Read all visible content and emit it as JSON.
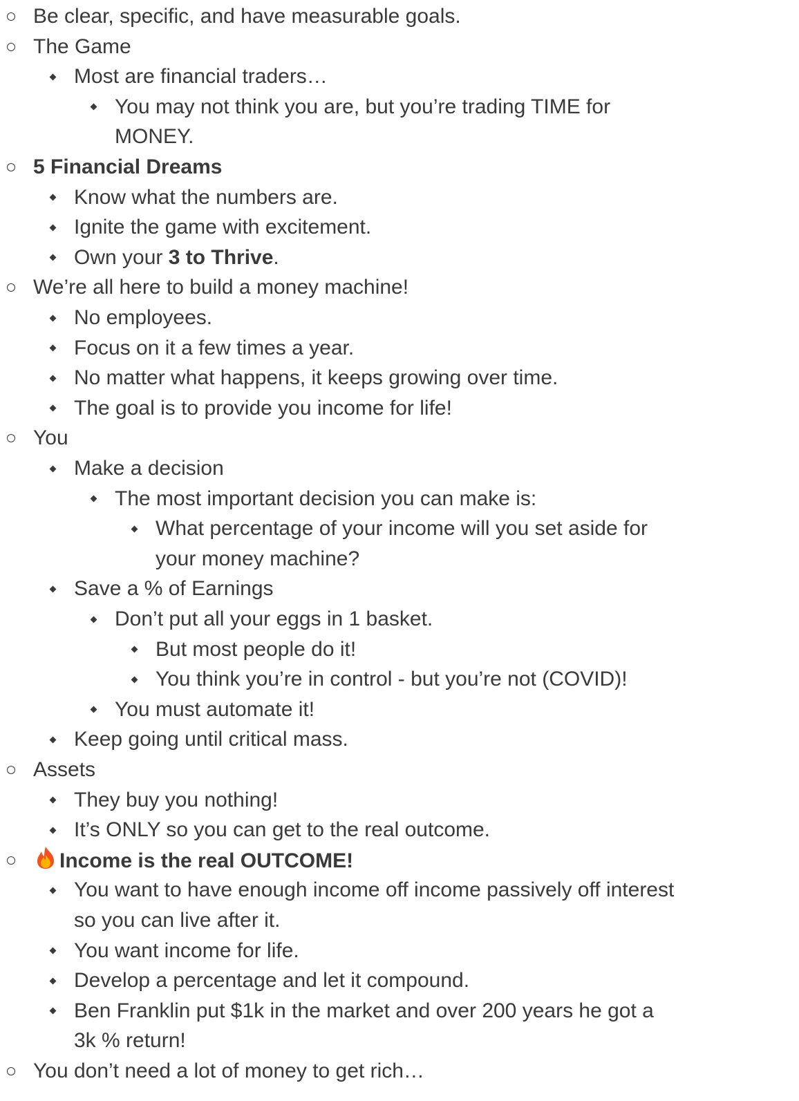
{
  "items": [
    {
      "level": 0,
      "lines": [
        [
          {
            "t": "Be clear, specific, and have measurable goals."
          }
        ]
      ]
    },
    {
      "level": 0,
      "lines": [
        [
          {
            "t": "The Game"
          }
        ]
      ]
    },
    {
      "level": 1,
      "lines": [
        [
          {
            "t": "Most are financial traders…"
          }
        ]
      ]
    },
    {
      "level": 2,
      "lines": [
        [
          {
            "t": "You may not think you are, but you’re trading TIME for"
          }
        ],
        [
          {
            "t": "MONEY."
          }
        ]
      ]
    },
    {
      "level": 0,
      "lines": [
        [
          {
            "t": "5 Financial Dreams",
            "b": true
          }
        ]
      ]
    },
    {
      "level": 1,
      "lines": [
        [
          {
            "t": "Know what the numbers are."
          }
        ]
      ]
    },
    {
      "level": 1,
      "lines": [
        [
          {
            "t": "Ignite the game with excitement."
          }
        ]
      ]
    },
    {
      "level": 1,
      "lines": [
        [
          {
            "t": "Own your "
          },
          {
            "t": "3 to Thrive",
            "b": true
          },
          {
            "t": "."
          }
        ]
      ]
    },
    {
      "level": 0,
      "lines": [
        [
          {
            "t": "We’re all here to build a money machine!"
          }
        ]
      ]
    },
    {
      "level": 1,
      "lines": [
        [
          {
            "t": "No employees."
          }
        ]
      ]
    },
    {
      "level": 1,
      "lines": [
        [
          {
            "t": "Focus on it a few times a year."
          }
        ]
      ]
    },
    {
      "level": 1,
      "lines": [
        [
          {
            "t": "No matter what happens, it keeps growing over time."
          }
        ]
      ]
    },
    {
      "level": 1,
      "lines": [
        [
          {
            "t": "The goal is to provide you income for life!"
          }
        ]
      ]
    },
    {
      "level": 0,
      "lines": [
        [
          {
            "t": "You"
          }
        ]
      ]
    },
    {
      "level": 1,
      "lines": [
        [
          {
            "t": "Make a decision"
          }
        ]
      ]
    },
    {
      "level": 2,
      "lines": [
        [
          {
            "t": "The most important decision you can make is:"
          }
        ]
      ]
    },
    {
      "level": 3,
      "lines": [
        [
          {
            "t": "What percentage of your income will you set aside for"
          }
        ],
        [
          {
            "t": "your money machine?"
          }
        ]
      ]
    },
    {
      "level": 1,
      "lines": [
        [
          {
            "t": "Save a % of Earnings"
          }
        ]
      ]
    },
    {
      "level": 2,
      "lines": [
        [
          {
            "t": "Don’t put all your eggs in 1 basket."
          }
        ]
      ]
    },
    {
      "level": 3,
      "lines": [
        [
          {
            "t": "But most people do it!"
          }
        ]
      ]
    },
    {
      "level": 3,
      "lines": [
        [
          {
            "t": "You think you’re in control - but you’re not (COVID)!"
          }
        ]
      ]
    },
    {
      "level": 2,
      "lines": [
        [
          {
            "t": "You must automate it!"
          }
        ]
      ]
    },
    {
      "level": 1,
      "lines": [
        [
          {
            "t": "Keep going until critical mass."
          }
        ]
      ]
    },
    {
      "level": 0,
      "lines": [
        [
          {
            "t": "Assets"
          }
        ]
      ]
    },
    {
      "level": 1,
      "lines": [
        [
          {
            "t": "They buy you nothing!"
          }
        ]
      ]
    },
    {
      "level": 1,
      "lines": [
        [
          {
            "t": "It’s ONLY so you can get to the real outcome."
          }
        ]
      ]
    },
    {
      "level": 0,
      "icon": "fire-icon",
      "lines": [
        [
          {
            "t": "Income is the real OUTCOME!",
            "b": true
          }
        ]
      ]
    },
    {
      "level": 1,
      "lines": [
        [
          {
            "t": "You want to have enough income off income passively off interest"
          }
        ],
        [
          {
            "t": "so you can live after it."
          }
        ]
      ]
    },
    {
      "level": 1,
      "lines": [
        [
          {
            "t": "You want income for life."
          }
        ]
      ]
    },
    {
      "level": 1,
      "lines": [
        [
          {
            "t": "Develop a percentage and let it compound."
          }
        ]
      ]
    },
    {
      "level": 1,
      "lines": [
        [
          {
            "t": "Ben Franklin put $1k in the market  and over 200 years he got a"
          }
        ],
        [
          {
            "t": "3k % return!"
          }
        ]
      ]
    },
    {
      "level": 0,
      "lines": [
        [
          {
            "t": "You don’t need a lot of money to get rich…"
          }
        ]
      ]
    }
  ]
}
